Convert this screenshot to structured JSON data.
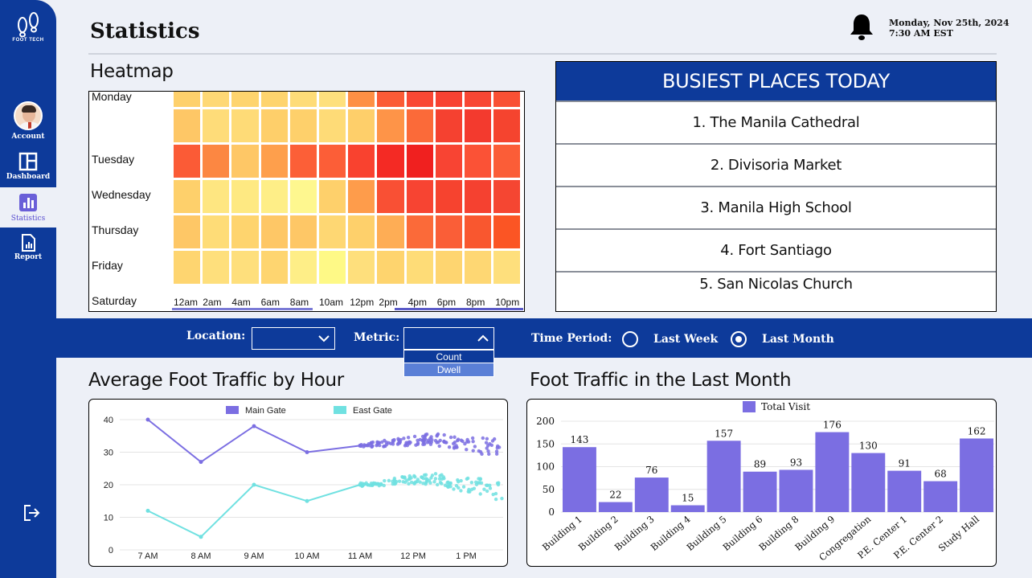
{
  "sidebar": {
    "brand": "FOOT TECH",
    "items": [
      {
        "label": "Account"
      },
      {
        "label": "Dashboard"
      },
      {
        "label": "Statistics"
      },
      {
        "label": "Report"
      }
    ]
  },
  "header": {
    "title": "Statistics",
    "date": "Monday, Nov 25th, 2024",
    "time": "7:30 AM EST"
  },
  "heatmap": {
    "title": "Heatmap",
    "days": [
      "Monday",
      "Tuesday",
      "Wednesday",
      "Thursday",
      "Friday",
      "Saturday"
    ],
    "hours": [
      "12am",
      "2am",
      "4am",
      "6am",
      "8am",
      "10am",
      "12pm",
      "2pm",
      "4pm",
      "6pm",
      "8pm",
      "10pm"
    ],
    "colors": [
      [
        "#fed06b",
        "#fed875",
        "#fed46e",
        "#fed46e",
        "#fedc78",
        "#fee07d",
        "#fe9045",
        "#fb5b36",
        "#f94834",
        "#f84232",
        "#f84633",
        "#f95034"
      ],
      [
        "#fec766",
        "#fedc79",
        "#fedb77",
        "#fecf6a",
        "#fed06b",
        "#fedb77",
        "#fecf6a",
        "#fe9448",
        "#fb6a39",
        "#f54130",
        "#f33a2e",
        "#f5442f"
      ],
      [
        "#fb5b36",
        "#fc8742",
        "#fec766",
        "#fe9f4c",
        "#fc5f37",
        "#fc5e37",
        "#f9422f",
        "#f42a24",
        "#f0201f",
        "#f84433",
        "#fb5236",
        "#fb5d37"
      ],
      [
        "#fed06b",
        "#fee681",
        "#fee982",
        "#feee87",
        "#fef78f",
        "#fed06b",
        "#fe9c4b",
        "#f95034",
        "#f74432",
        "#f6432f",
        "#f54130",
        "#f54632"
      ],
      [
        "#fec766",
        "#fedc77",
        "#fed46e",
        "#fec766",
        "#fec766",
        "#fed773",
        "#fed06b",
        "#fead55",
        "#fb6a39",
        "#fa5e37",
        "#f9572f",
        "#fb5524"
      ],
      [
        "#fed570",
        "#fedf7c",
        "#fedf7c",
        "#fed570",
        "#feee87",
        "#fef986",
        "#fedf7c",
        "#fed46e",
        "#fedc77",
        "#fed570",
        "#fed773",
        "#fedf7c"
      ]
    ]
  },
  "busiest": {
    "title": "BUSIEST PLACES TODAY",
    "items": [
      "1. The Manila Cathedral",
      "2. Divisoria Market",
      "3. Manila High School",
      "4. Fort Santiago",
      "5. San Nicolas Church"
    ]
  },
  "filters": {
    "location_label": "Location:",
    "location_value": "",
    "metric_label": "Metric:",
    "metric_value": "",
    "metric_options": [
      "Count",
      "Dwell"
    ],
    "metric_hovered": "Dwell",
    "time_label": "Time Period:",
    "time_options": [
      {
        "label": "Last Week",
        "checked": false
      },
      {
        "label": "Last Month",
        "checked": true
      }
    ]
  },
  "line_chart_title": "Average Foot Traffic by Hour",
  "bar_chart_title": "Foot Traffic in the Last Month",
  "chart_data": [
    {
      "type": "line",
      "title": "Average Foot Traffic by Hour",
      "categories": [
        "7 AM",
        "8 AM",
        "9 AM",
        "10 AM",
        "11 AM",
        "12 PM",
        "1 PM"
      ],
      "series": [
        {
          "name": "Main Gate",
          "color": "#7b6ee2",
          "values": [
            40,
            27,
            38,
            30,
            32,
            34,
            31
          ],
          "observed_through": 4
        },
        {
          "name": "East Gate",
          "color": "#70e1e1",
          "values": [
            12,
            4,
            20,
            15,
            20,
            22,
            18
          ],
          "observed_through": 4
        }
      ],
      "ylim": [
        0,
        40
      ],
      "yticks": [
        0,
        10,
        20,
        30,
        40
      ],
      "legend": "top-center",
      "grid": true
    },
    {
      "type": "bar",
      "title": "Foot Traffic in the Last Month",
      "categories": [
        "Building 1",
        "Building 2",
        "Building 3",
        "Building 4",
        "Building 5",
        "Building 6",
        "Building 8",
        "Building 9",
        "Congregation",
        "P.E. Center 1",
        "P.E. Center 2",
        "Study Hall"
      ],
      "series": [
        {
          "name": "Total Visit",
          "color": "#7b6ee2",
          "values": [
            143,
            22,
            76,
            15,
            157,
            89,
            93,
            176,
            130,
            91,
            68,
            162
          ]
        }
      ],
      "ylim": [
        0,
        200
      ],
      "yticks": [
        0,
        50,
        100,
        150,
        200
      ],
      "legend": "top-center",
      "grid": true
    }
  ]
}
